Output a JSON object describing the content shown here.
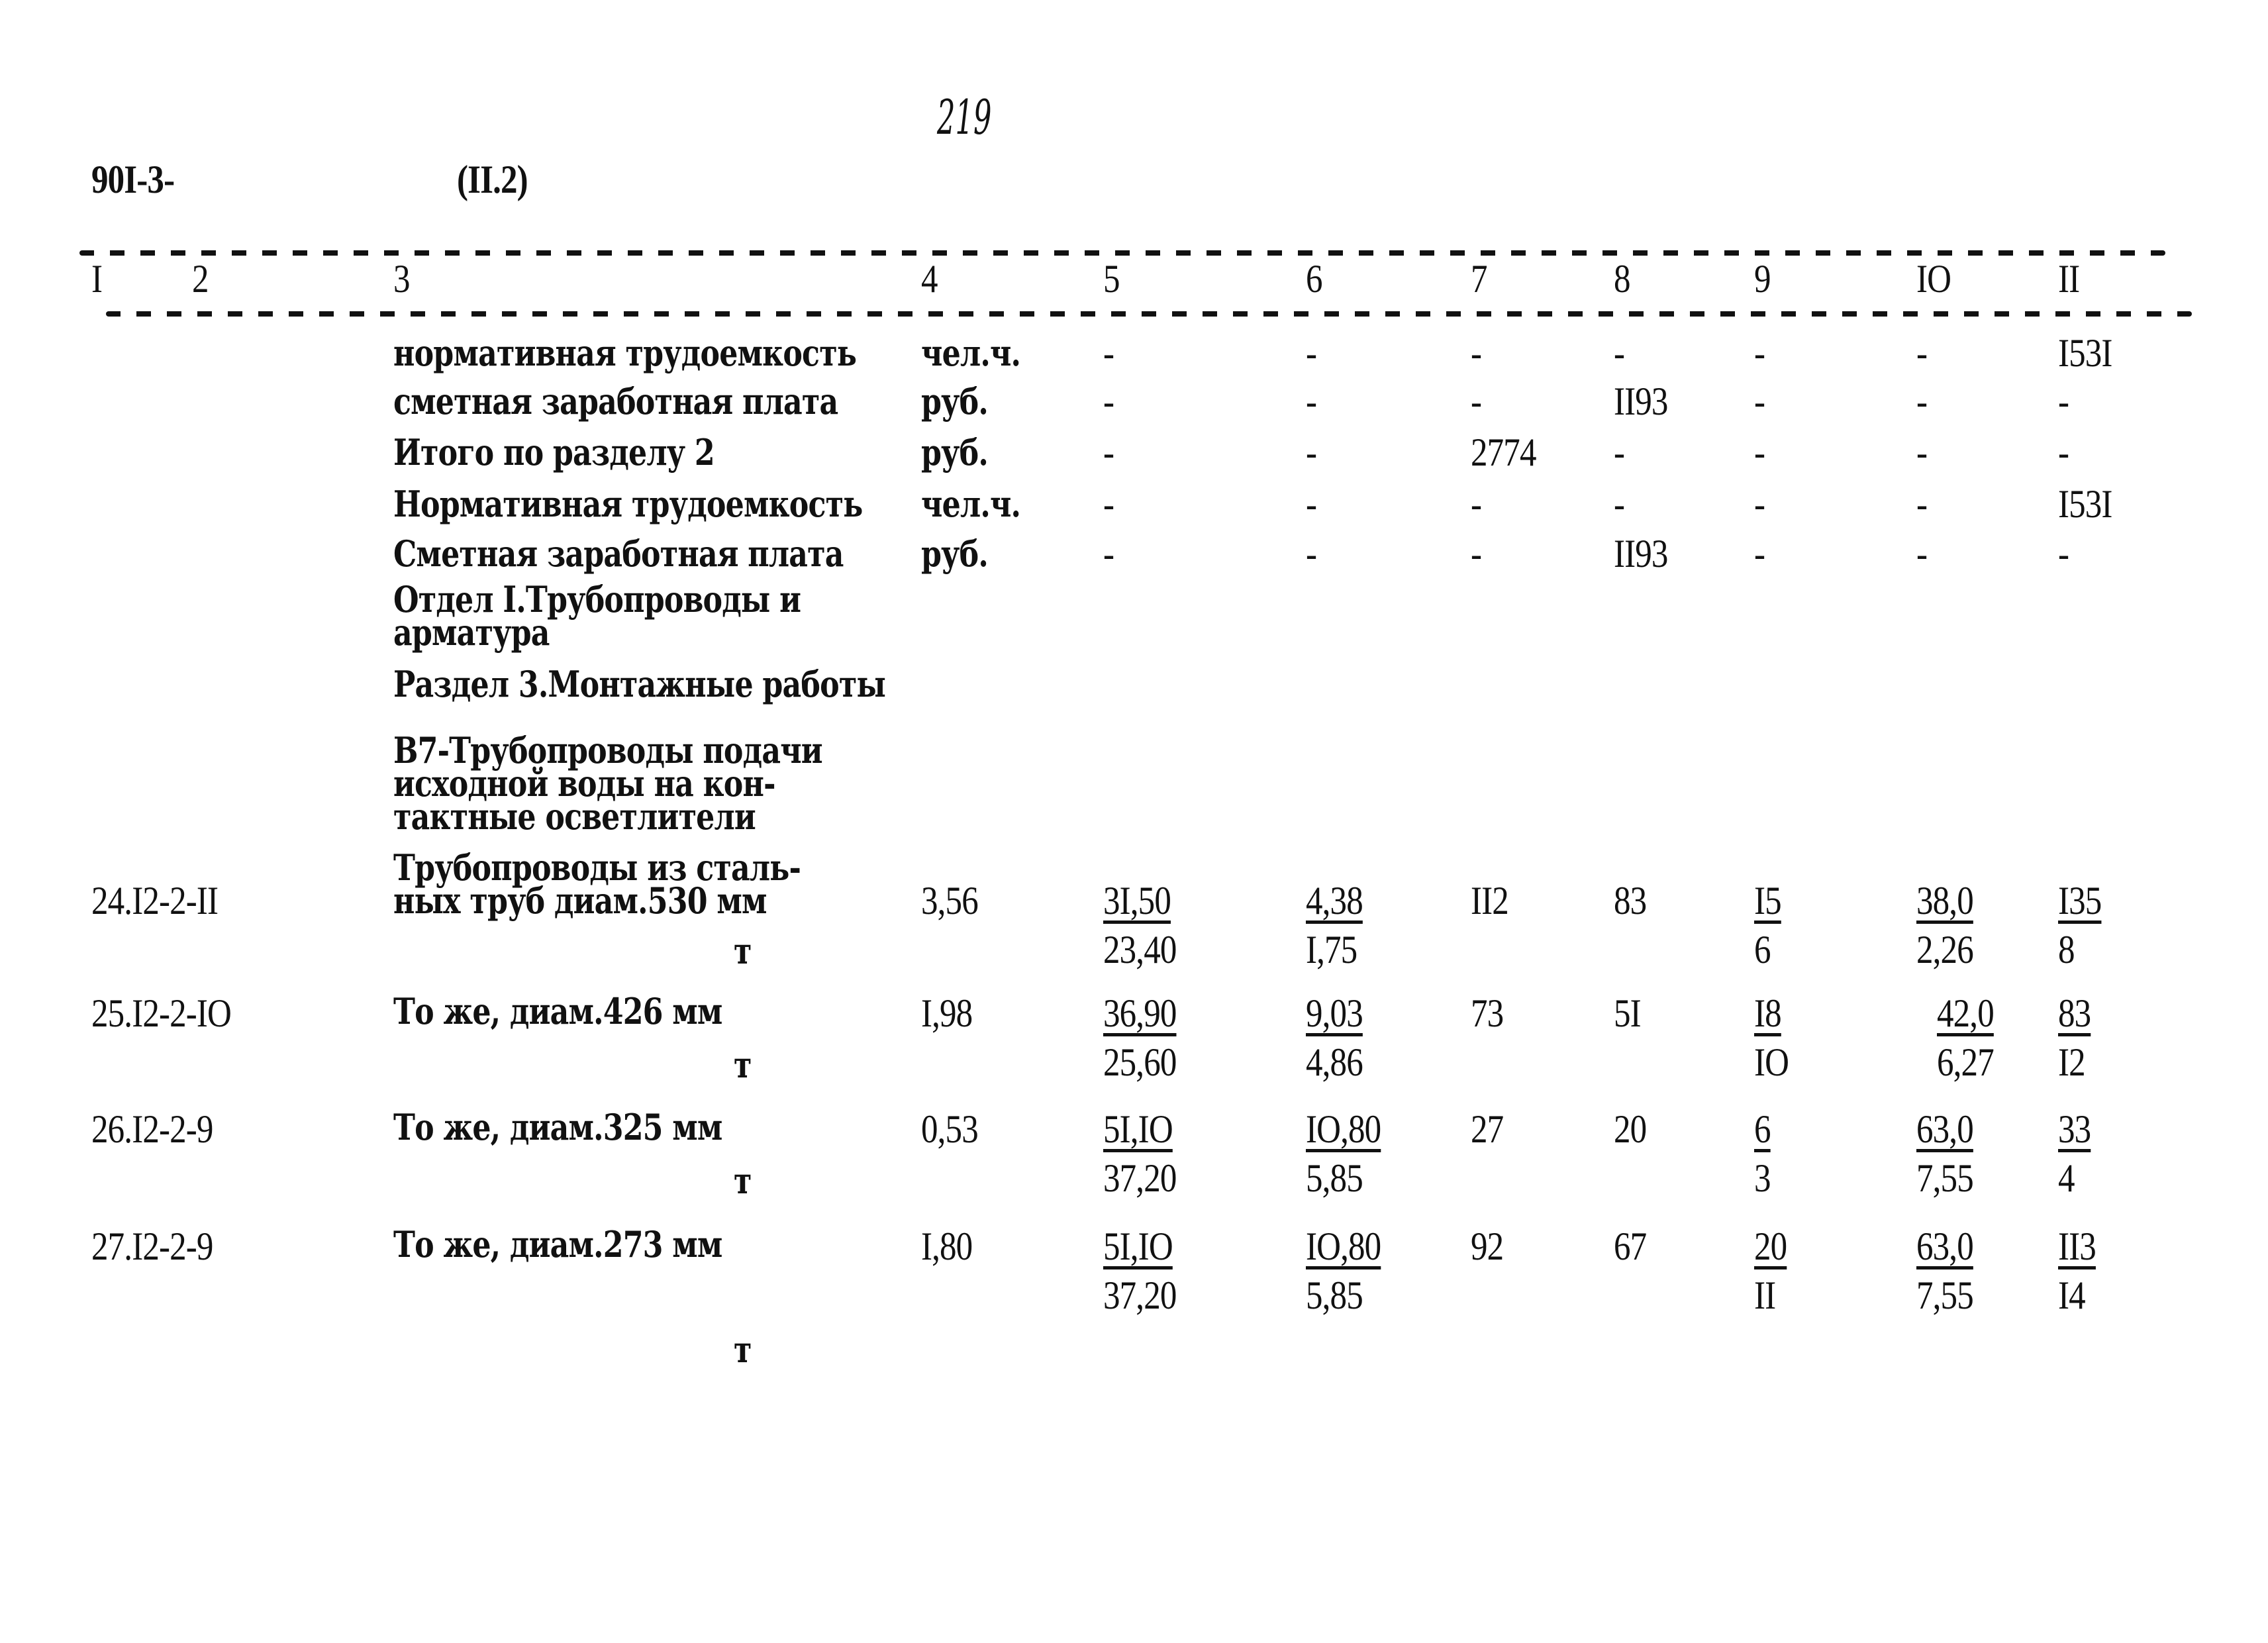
{
  "page_number": "219",
  "doc_code": "90I-3-",
  "section_ref": "(II.2)",
  "column_headers": [
    "I",
    "2",
    "3",
    "4",
    "5",
    "6",
    "7",
    "8",
    "9",
    "IO",
    "II"
  ],
  "summary_rows": [
    {
      "name": "нормативная трудоемкость",
      "unit": "чел.ч.",
      "c5": "-",
      "c6": "-",
      "c7": "-",
      "c8": "-",
      "c9": "-",
      "c10": "-",
      "c11": "I53I"
    },
    {
      "name": "сметная заработная плата",
      "unit": "руб.",
      "c5": "-",
      "c6": "-",
      "c7": "-",
      "c8": "II93",
      "c9": "-",
      "c10": "-",
      "c11": "-"
    },
    {
      "name": "Итого по разделу 2",
      "unit": "руб.",
      "c5": "-",
      "c6": "-",
      "c7": "2774",
      "c8": "-",
      "c9": "-",
      "c10": "-",
      "c11": "-"
    },
    {
      "name": "Нормативная трудоемкость",
      "unit": "чел.ч.",
      "c5": "-",
      "c6": "-",
      "c7": "-",
      "c8": "-",
      "c9": "-",
      "c10": "-",
      "c11": "I53I"
    },
    {
      "name": "Сметная заработная плата",
      "unit": "руб.",
      "c5": "-",
      "c6": "-",
      "c7": "-",
      "c8": "II93",
      "c9": "-",
      "c10": "-",
      "c11": "-"
    }
  ],
  "headings": {
    "otdel": "Отдел I.Трубопроводы и\nарматура",
    "razdel": "Раздел 3.Монтажные работы",
    "group": "В7-Трубопроводы подачи\nисходной воды на кон-\nтактные осветлители"
  },
  "items": [
    {
      "code": "24.I2-2-II",
      "desc": "Трубопроводы из сталь-\nных труб диам.530 мм",
      "unit": "т",
      "qty": "3,56",
      "c5_top": "3I,50",
      "c5_bot": "23,40",
      "c6_top": "4,38",
      "c6_bot": "I,75",
      "c7": "II2",
      "c8": "83",
      "c9_top": "I5",
      "c9_bot": "6",
      "c10_top": "38,0",
      "c10_bot": "2,26",
      "c11_top": "I35",
      "c11_bot": "8"
    },
    {
      "code": "25.I2-2-IO",
      "desc": "То же, диам.426 мм",
      "unit": "т",
      "qty": "I,98",
      "c5_top": "36,90",
      "c5_bot": "25,60",
      "c6_top": "9,03",
      "c6_bot": "4,86",
      "c7": "73",
      "c8": "5I",
      "c9_top": "I8",
      "c9_bot": "IO",
      "c10_top": "42,0",
      "c10_bot": "6,27",
      "c11_top": "83",
      "c11_bot": "I2"
    },
    {
      "code": "26.I2-2-9",
      "desc": "То же, диам.325 мм",
      "unit": "т",
      "qty": "0,53",
      "c5_top": "5I,IO",
      "c5_bot": "37,20",
      "c6_top": "IO,80",
      "c6_bot": "5,85",
      "c7": "27",
      "c8": "20",
      "c9_top": "6",
      "c9_bot": "3",
      "c10_top": "63,0",
      "c10_bot": "7,55",
      "c11_top": "33",
      "c11_bot": "4"
    },
    {
      "code": "27.I2-2-9",
      "desc": "То же, диам.273 мм",
      "unit": "т",
      "qty": "I,80",
      "c5_top": "5I,IO",
      "c5_bot": "37,20",
      "c6_top": "IO,80",
      "c6_bot": "5,85",
      "c7": "92",
      "c8": "67",
      "c9_top": "20",
      "c9_bot": "II",
      "c10_top": "63,0",
      "c10_bot": "7,55",
      "c11_top": "II3",
      "c11_bot": "I4"
    }
  ]
}
